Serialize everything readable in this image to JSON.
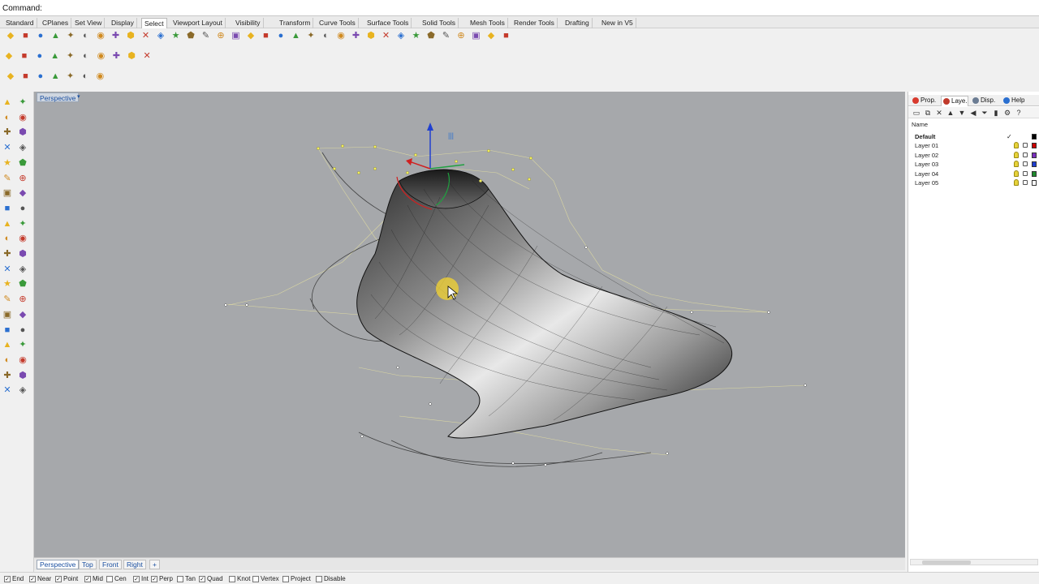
{
  "command": {
    "label": "Command:",
    "value": ""
  },
  "toolbar_tabs": [
    {
      "label": "Standard",
      "active": false
    },
    {
      "label": "CPlanes",
      "active": false
    },
    {
      "label": "Set View",
      "active": false
    },
    {
      "label": "Display",
      "active": false
    },
    {
      "label": "Select",
      "active": true
    },
    {
      "label": "Viewport Layout",
      "active": false
    },
    {
      "label": "Visibility",
      "active": false
    },
    {
      "label": "Transform",
      "active": false
    },
    {
      "label": "Curve Tools",
      "active": false
    },
    {
      "label": "Surface Tools",
      "active": false
    },
    {
      "label": "Solid Tools",
      "active": false
    },
    {
      "label": "Mesh Tools",
      "active": false
    },
    {
      "label": "Render Tools",
      "active": false
    },
    {
      "label": "Drafting",
      "active": false
    },
    {
      "label": "New in V5",
      "active": false
    }
  ],
  "icons": {
    "row1": [
      "select-all-icon",
      "select-none-icon",
      "invert-icon",
      "select-last-icon",
      "select-previous-icon",
      "select-points-icon",
      "select-curves-icon",
      "select-polylines-icon",
      "select-surfaces-icon",
      "select-polysurfaces-icon",
      "select-lights-icon",
      "select-meshes-icon",
      "select-dupes-icon",
      "select-color-icon",
      "select-layer-icon",
      "select-lock-icon",
      "select-group-icon",
      "select-open-icon",
      "select-closed-icon",
      "select-cap-icon",
      "select-blocks-icon",
      "select-text-icon",
      "select-dims-icon",
      "select-hatch-icon",
      "select-annot-icon",
      "select-planar-icon",
      "select-bad-icon",
      "select-small-icon",
      "select-size-icon",
      "select-edge-icon",
      "select-brep-icon",
      "select-history-icon",
      "select-render-icon",
      "select-by-name-icon"
    ],
    "row2": [
      "material-icon",
      "texture-icon",
      "render-r-icon",
      "render-rt-icon",
      "sun-icon",
      "light-icon",
      "spotlight-icon",
      "environment-icon",
      "render-settings-icon",
      "render-sphere-icon"
    ],
    "row3": [
      "point-light-icon",
      "sun-light-icon",
      "bulb-icon",
      "sphere-light-icon",
      "rect-light-icon",
      "spot-light-icon",
      "directional-light-icon"
    ]
  },
  "left_toolbar_icons": [
    "select-arrow-icon",
    "points-icon",
    "polyline-icon",
    "curve-icon",
    "circle-icon",
    "arc-icon",
    "ellipse-icon",
    "rectangle-icon",
    "polygon-icon",
    "freeform-icon",
    "surface-icon",
    "extrude-icon",
    "box-icon",
    "sphere-icon",
    "cylinder-icon",
    "mesh-icon",
    "boolean-icon",
    "fillet-icon",
    "trim-icon",
    "split-icon",
    "move-icon",
    "rotate-icon",
    "scale-icon",
    "array-icon",
    "text-icon",
    "dimension-icon",
    "block-icon",
    "group-icon",
    "render-icon",
    "light-icon",
    "grid-icon",
    "snap-icon",
    "analyze-icon",
    "curvature-icon",
    "check-icon",
    "history-icon",
    "edit-icon",
    "layer-icon",
    "paint-icon",
    "warning-icon"
  ],
  "viewport": {
    "title": "Perspective"
  },
  "viewport_tabs": [
    {
      "label": "Perspective",
      "active": true
    },
    {
      "label": "Top",
      "active": false
    },
    {
      "label": "Front",
      "active": false
    },
    {
      "label": "Right",
      "active": false
    },
    {
      "label": "+",
      "active": false
    }
  ],
  "osnaps": [
    {
      "label": "End",
      "checked": true
    },
    {
      "label": "Near",
      "checked": true
    },
    {
      "label": "Point",
      "checked": true
    },
    {
      "label": "Mid",
      "checked": true
    },
    {
      "label": "Cen",
      "checked": false
    },
    {
      "label": "Int",
      "checked": true
    },
    {
      "label": "Perp",
      "checked": true
    },
    {
      "label": "Tan",
      "checked": false
    },
    {
      "label": "Quad",
      "checked": true
    },
    {
      "label": "Knot",
      "checked": false
    },
    {
      "label": "Vertex",
      "checked": false
    },
    {
      "label": "Project",
      "checked": false
    },
    {
      "label": "Disable",
      "checked": false
    }
  ],
  "panel": {
    "tabs": [
      {
        "label": "Prop.",
        "icon": "properties-icon",
        "color": "#d83a2e",
        "active": false
      },
      {
        "label": "Laye.",
        "icon": "layers-icon",
        "color": "#c0392b",
        "active": true
      },
      {
        "label": "Disp.",
        "icon": "display-icon",
        "color": "#6b7c93",
        "active": false
      },
      {
        "label": "Help",
        "icon": "help-icon",
        "color": "#2a6fd0",
        "active": false
      }
    ],
    "column_header": "Name",
    "layers": [
      {
        "name": "Default",
        "current": true,
        "color": "#000000"
      },
      {
        "name": "Layer 01",
        "current": false,
        "color": "#cc0000"
      },
      {
        "name": "Layer 02",
        "current": false,
        "color": "#7b2fbf"
      },
      {
        "name": "Layer 03",
        "current": false,
        "color": "#1f3fd0"
      },
      {
        "name": "Layer 04",
        "current": false,
        "color": "#1e8a2e"
      },
      {
        "name": "Layer 05",
        "current": false,
        "color": "#ffffff"
      }
    ],
    "current_mark": "✓"
  }
}
